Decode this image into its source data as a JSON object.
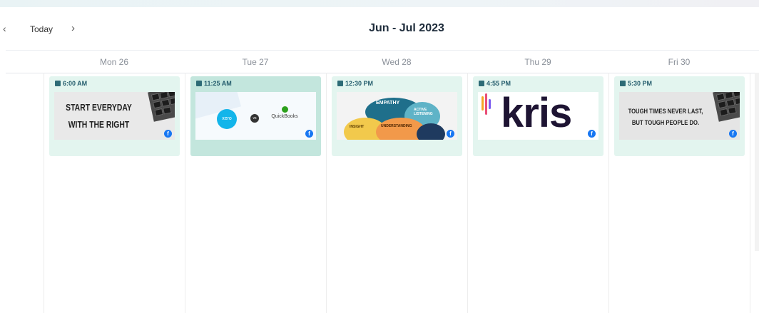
{
  "toolbar": {
    "prev_icon": "‹",
    "today_label": "Today",
    "next_icon": "›",
    "title": "Jun - Jul 2023"
  },
  "days": [
    "Mon 26",
    "Tue 27",
    "Wed 28",
    "Thu 29",
    "Fri 30"
  ],
  "posts": [
    {
      "time": "6:00 AM",
      "image_text": [
        "START EVERYDAY",
        "WITH THE RIGHT"
      ],
      "network": "facebook",
      "selected": false
    },
    {
      "time": "11:25 AM",
      "image_text": [
        "xero",
        "vs",
        "QuickBooks"
      ],
      "network": "facebook",
      "selected": true
    },
    {
      "time": "12:30 PM",
      "image_text": [
        "EMPATHY",
        "ACTIVE LISTENING",
        "INSIGHT",
        "UNDERSTANDING"
      ],
      "network": "facebook",
      "selected": false
    },
    {
      "time": "4:55 PM",
      "image_text": [
        "kris"
      ],
      "network": "facebook",
      "selected": false
    },
    {
      "time": "5:30 PM",
      "image_text": [
        "TOUGH TIMES NEVER LAST,",
        "BUT TOUGH PEOPLE DO."
      ],
      "network": "facebook",
      "selected": false
    }
  ],
  "icons": {
    "post": "calendar-post-icon",
    "network": "facebook-icon"
  },
  "colors": {
    "card_bg": "#e3f5ef",
    "card_selected_bg": "#c3e6dd",
    "time_text": "#255d6d",
    "facebook": "#1877f2"
  }
}
